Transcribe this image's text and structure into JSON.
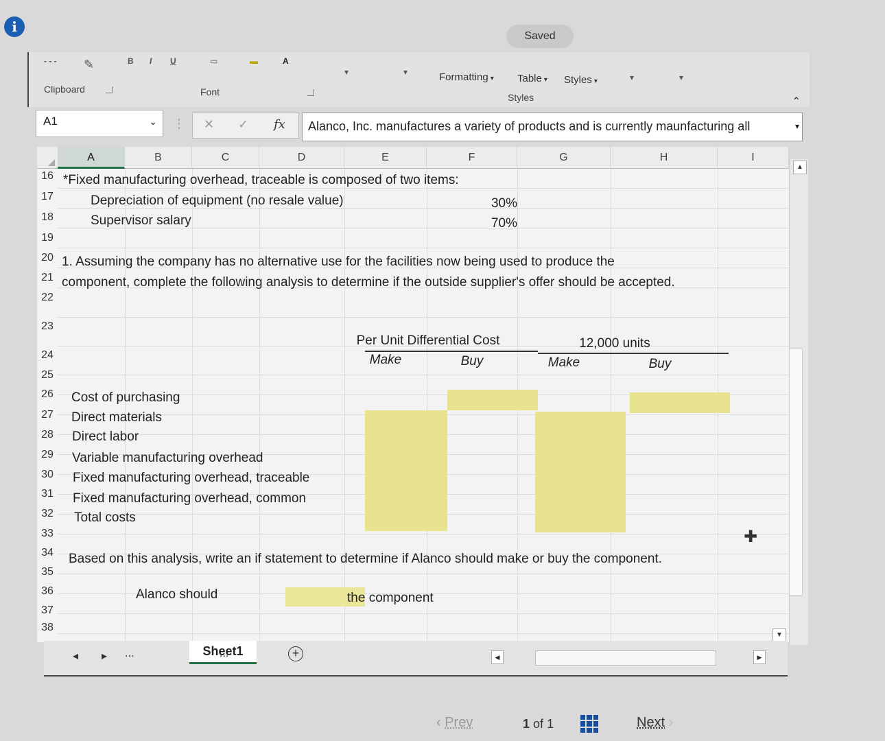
{
  "header": {
    "saved_label": "Saved"
  },
  "ribbon": {
    "clipboard": "Clipboard",
    "font": "Font",
    "conditional_formatting": "Formatting",
    "format_table": "Table",
    "cell_styles": "Styles",
    "styles_group": "Styles"
  },
  "namebox": {
    "value": "A1"
  },
  "formula_bar": {
    "fx": "fx",
    "value": "Alanco, Inc. manufactures a variety of products and is currently maunfacturing all"
  },
  "columns": [
    "A",
    "B",
    "C",
    "D",
    "E",
    "F",
    "G",
    "H",
    "I"
  ],
  "rows": [
    "16",
    "17",
    "18",
    "19",
    "20",
    "21",
    "22",
    "23",
    "24",
    "25",
    "26",
    "27",
    "28",
    "29",
    "30",
    "31",
    "32",
    "33",
    "34",
    "35",
    "36",
    "37",
    "38"
  ],
  "cells": {
    "r16": "*Fixed manufacturing overhead, traceable is composed of two items:",
    "r17_label": "Depreciation of equipment (no resale value)",
    "r17_value": "30%",
    "r18_label": "Supervisor salary",
    "r18_value": "70%",
    "r20": "1. Assuming the company has no alternative use for the facilities now being used to produce the",
    "r21": "component, complete the following analysis to determine if the outside supplier's offer should be accepted.",
    "per_unit_header": "Per Unit Differential Cost",
    "units_header": "12,000 units",
    "make_1": "Make",
    "buy_1": "Buy",
    "make_2": "Make",
    "buy_2": "Buy",
    "r26": "Cost of purchasing",
    "r27": "Direct materials",
    "r28": "Direct labor",
    "r29": "Variable manufacturing overhead",
    "r30": "Fixed manufacturing overhead, traceable",
    "r31": "Fixed manufacturing overhead, common",
    "r32": "Total costs",
    "r34": "Based on this analysis, write an if statement to determine if Alanco should make or buy the component.",
    "r36_left": "Alanco should",
    "r36_right": "the component"
  },
  "tabs": {
    "sheet1": "Sheet1",
    "ellipsis": "..."
  },
  "navigation": {
    "prev": "Prev",
    "next": "Next",
    "page_current": "1",
    "page_of": "of",
    "page_total": "1"
  },
  "colors": {
    "input_yellow": "#e7e38f",
    "excel_green": "#217346",
    "info_blue": "#1a5fb4"
  }
}
